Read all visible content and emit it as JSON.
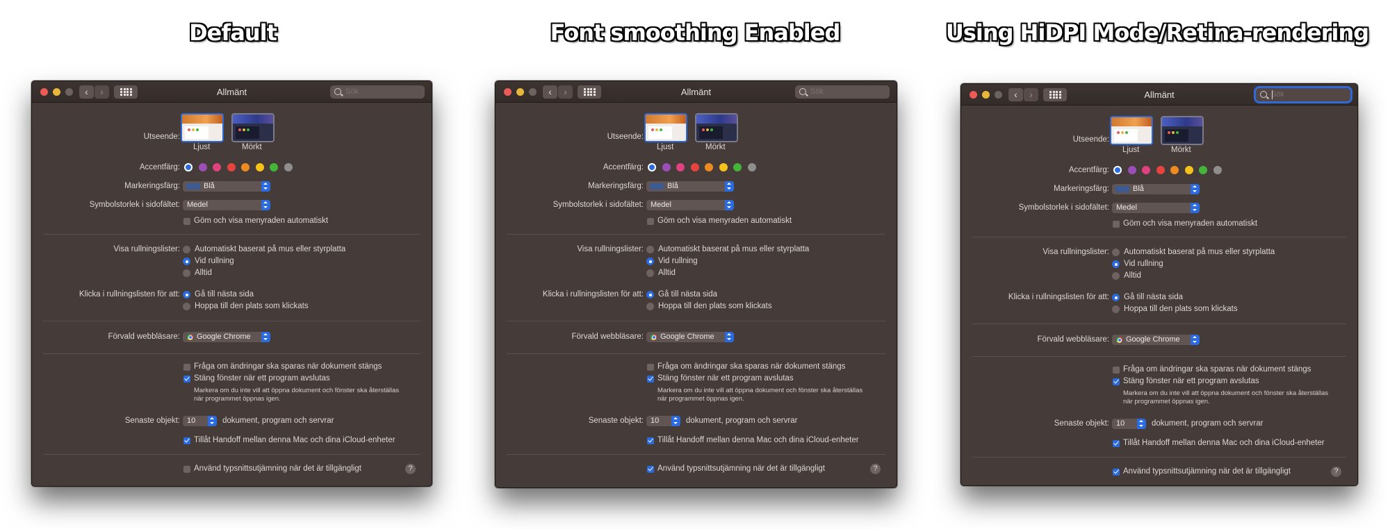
{
  "headings": [
    "Default",
    "Font smoothing Enabled",
    "Using HiDPI Mode/Retina-rendering"
  ],
  "window": {
    "title": "Allmänt",
    "search_placeholder": "Sök",
    "back_icon": "chevron-left-icon",
    "forward_icon": "chevron-right-icon",
    "grid_icon": "show-all-grid-icon"
  },
  "appearance": {
    "label": "Utseende:",
    "options": [
      "Ljust",
      "Mörkt"
    ],
    "selected": "Ljust"
  },
  "accent": {
    "label": "Accentfärg:",
    "colors": [
      "#2b6be0",
      "#9a4fb8",
      "#e0417f",
      "#e5443f",
      "#ee8a22",
      "#f4c21b",
      "#45b53a",
      "#8e8e8e"
    ],
    "selected": 0
  },
  "highlight": {
    "label": "Markeringsfärg:",
    "value": "Blå"
  },
  "sidebar_icon": {
    "label": "Symbolstorlek i sidofältet:",
    "value": "Medel"
  },
  "menubar": {
    "label": "Göm och visa menyraden automatiskt",
    "checked": false
  },
  "scrollbars": {
    "label": "Visa rullningslister:",
    "options": [
      "Automatiskt baserat på mus eller styrplatta",
      "Vid rullning",
      "Alltid"
    ],
    "selected": 1
  },
  "click_scroll": {
    "label": "Klicka i rullningslisten för att:",
    "options": [
      "Gå till nästa sida",
      "Hoppa till den plats som klickats"
    ],
    "selected": 0
  },
  "browser": {
    "label": "Förvald webbläsare:",
    "value": "Google Chrome"
  },
  "documents": {
    "ask_label": "Fråga om ändringar ska sparas när dokument stängs",
    "ask_checked": false,
    "close_label": "Stäng fönster när ett program avslutas",
    "close_checked": true,
    "note_line1": "Markera om du inte vill att öppna dokument och fönster ska återställas",
    "note_line2": "när programmet öppnas igen."
  },
  "recent": {
    "label": "Senaste objekt:",
    "value": "10",
    "suffix": "dokument, program och servrar"
  },
  "handoff": {
    "label": "Tillåt Handoff mellan denna Mac och dina iCloud-enheter",
    "checked": true
  },
  "font_smoothing": {
    "label": "Använd typsnittsutjämning när det är tillgängligt",
    "checked_per_panel": [
      false,
      true,
      true
    ]
  },
  "help_icon": "help-icon"
}
